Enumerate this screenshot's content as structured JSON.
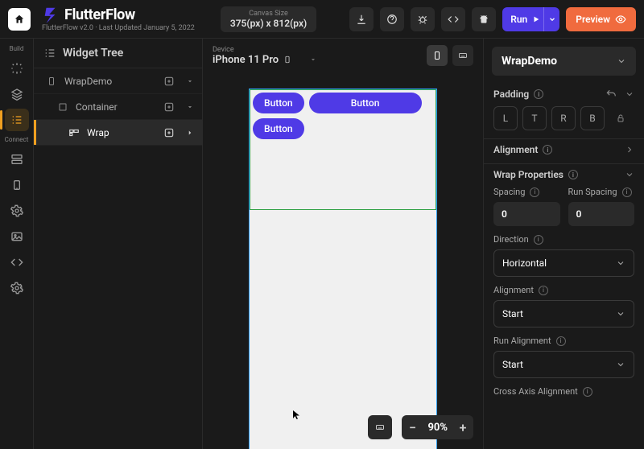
{
  "brand": {
    "name": "FlutterFlow",
    "meta": "FlutterFlow v2.0 · Last Updated January 5, 2022"
  },
  "canvasSize": {
    "label": "Canvas Size",
    "value": "375(px) x 812(px)"
  },
  "topActions": {
    "run": "Run",
    "preview": "Preview"
  },
  "railSections": {
    "build": "Build",
    "connect": "Connect"
  },
  "tree": {
    "title": "Widget Tree",
    "rows": [
      {
        "label": "WrapDemo"
      },
      {
        "label": "Container"
      },
      {
        "label": "Wrap"
      }
    ]
  },
  "device": {
    "label": "Device",
    "name": "iPhone 11 Pro"
  },
  "canvasButtons": {
    "b1": "Button",
    "b2": "Button",
    "b3": "Button"
  },
  "zoom": {
    "value": "90%"
  },
  "props": {
    "headTitle": "WrapDemo",
    "padding": {
      "title": "Padding",
      "l": "L",
      "t": "T",
      "r": "R",
      "b": "B"
    },
    "alignmentSection": "Alignment",
    "wrap": {
      "title": "Wrap Properties",
      "spacingLabel": "Spacing",
      "spacingVal": "0",
      "runSpacingLabel": "Run Spacing",
      "runSpacingVal": "0",
      "directionLabel": "Direction",
      "directionVal": "Horizontal",
      "alignmentLabel": "Alignment",
      "alignmentVal": "Start",
      "runAlignLabel": "Run Alignment",
      "runAlignVal": "Start",
      "crossAxisLabel": "Cross Axis Alignment"
    }
  }
}
